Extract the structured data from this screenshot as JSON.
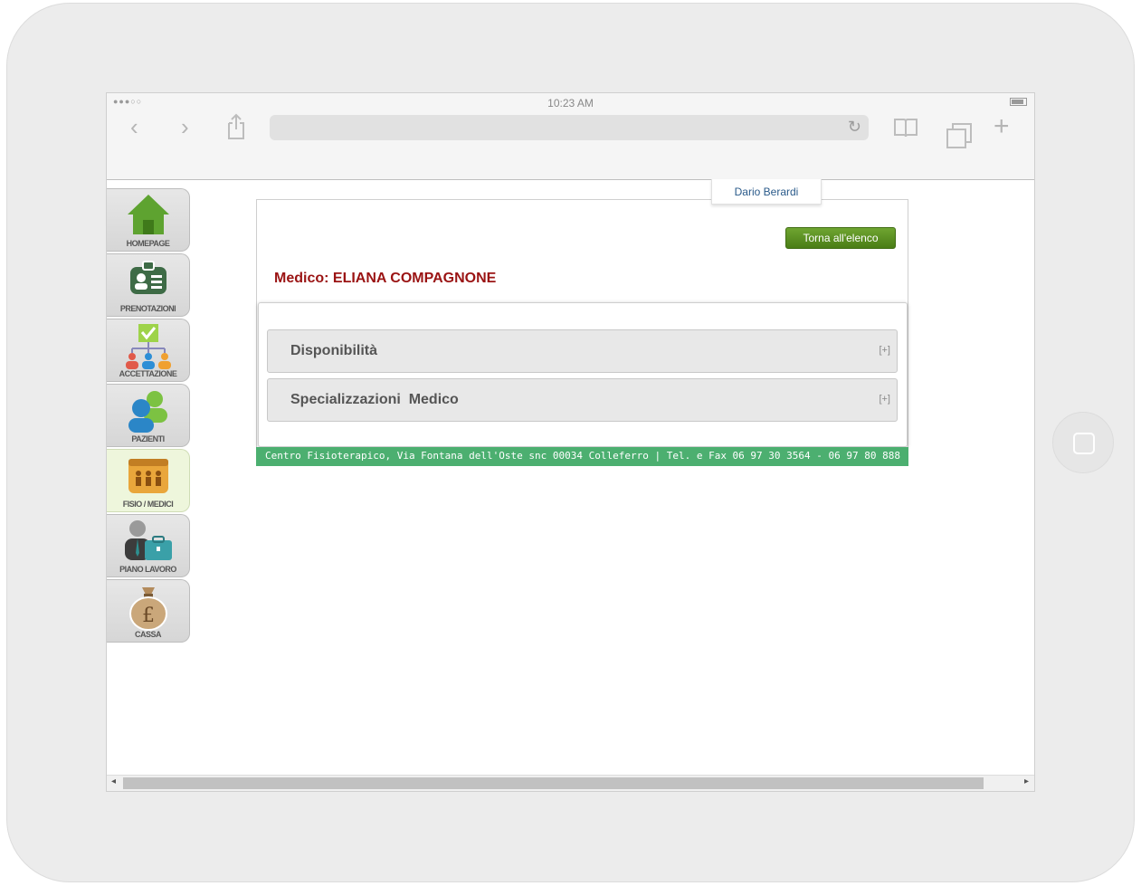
{
  "status_bar": {
    "signal": "●●●○○",
    "time": "10:23 AM"
  },
  "browser": {
    "url": ""
  },
  "user": {
    "name": "Dario Berardi"
  },
  "sidebar": {
    "items": [
      {
        "label": "HOMEPAGE",
        "icon": "home-icon"
      },
      {
        "label": "PRENOTAZIONI",
        "icon": "badge-icon"
      },
      {
        "label": "ACCETTAZIONE",
        "icon": "org-chart-icon"
      },
      {
        "label": "PAZIENTI",
        "icon": "users-icon"
      },
      {
        "label": "FISIO / MEDICI",
        "icon": "staff-folder-icon",
        "active": true
      },
      {
        "label": "PIANO LAVORO",
        "icon": "worker-briefcase-icon"
      },
      {
        "label": "CASSA",
        "icon": "money-bag-icon"
      }
    ]
  },
  "main": {
    "back_button": "Torna all'elenco",
    "title": "Medico: ELIANA COMPAGNONE",
    "sections": [
      {
        "title": "Disponibilità",
        "toggle": "[+]"
      },
      {
        "title": "Specializzazioni  Medico",
        "toggle": "[+]"
      }
    ],
    "footer": "Centro Fisioterapico, Via Fontana dell'Oste snc 00034 Colleferro | Tel. e Fax 06 97 30 3564 - 06 97 80 888"
  },
  "colors": {
    "title": "#9a1313",
    "footer_bg": "#4caf70",
    "button_bg": "#5a9122"
  }
}
